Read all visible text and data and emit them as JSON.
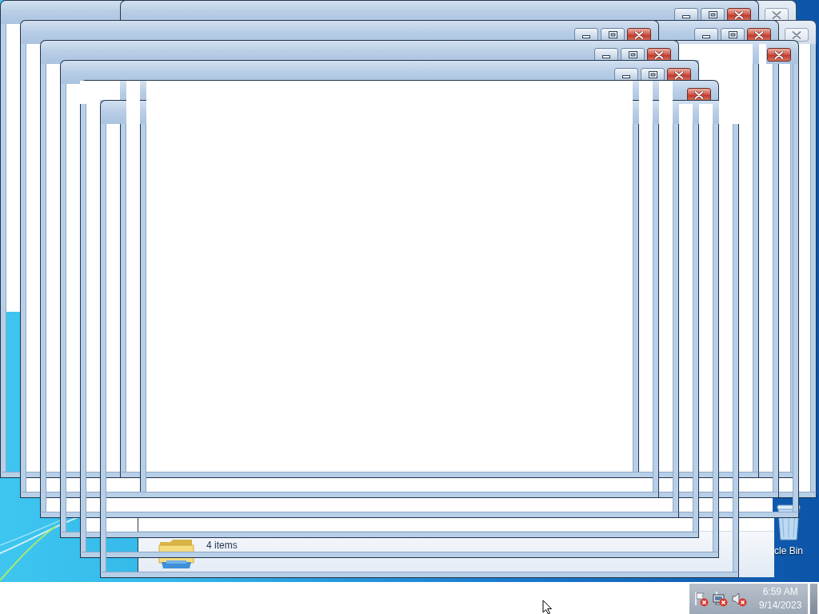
{
  "desktop": {
    "icons": [
      {
        "label": "cle Bin"
      }
    ]
  },
  "explorer_window": {
    "details_text": "4 items"
  },
  "window_frames": [
    {
      "active": true
    },
    {
      "active": false,
      "buttons": [
        {
          "kind": "close"
        }
      ]
    },
    {
      "active": true,
      "buttons": [
        {
          "kind": "minimize"
        },
        {
          "kind": "maximize"
        },
        {
          "kind": "close"
        }
      ]
    },
    {
      "active": false,
      "buttons": [
        {
          "kind": "close"
        }
      ]
    },
    {
      "active": true,
      "buttons": [
        {
          "kind": "minimize"
        },
        {
          "kind": "maximize"
        },
        {
          "kind": "close"
        }
      ]
    },
    {
      "active": true,
      "buttons": [
        {
          "kind": "minimize"
        },
        {
          "kind": "maximize"
        },
        {
          "kind": "close"
        }
      ]
    },
    {
      "active": true,
      "buttons": [
        {
          "kind": "close"
        }
      ]
    },
    {
      "active": true,
      "buttons": [
        {
          "kind": "minimize"
        },
        {
          "kind": "maximize"
        },
        {
          "kind": "close"
        }
      ]
    },
    {
      "active": true,
      "buttons": [
        {
          "kind": "minimize"
        },
        {
          "kind": "maximize"
        },
        {
          "kind": "close"
        }
      ]
    },
    {
      "active": true,
      "buttons": [
        {
          "kind": "close"
        }
      ]
    },
    {
      "active": true
    }
  ],
  "taskbar": {
    "tray_icons": [
      {
        "kind": "flag",
        "error": true
      },
      {
        "kind": "network",
        "error": true
      },
      {
        "kind": "speaker",
        "muted": true
      }
    ],
    "clock": {
      "time": "6:59 AM",
      "date": "9/14/2023"
    }
  }
}
